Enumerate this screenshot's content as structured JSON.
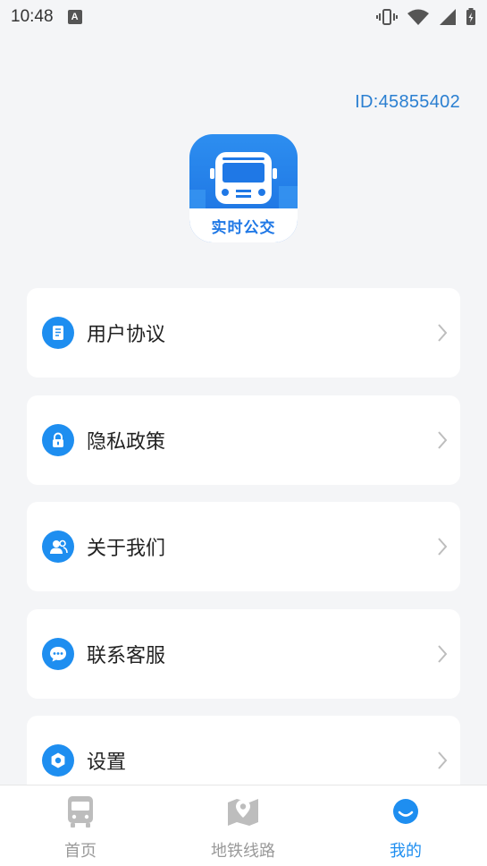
{
  "status_bar": {
    "time": "10:48",
    "indicator": "A"
  },
  "profile": {
    "user_id": "ID:45855402",
    "app_name": "实时公交"
  },
  "menu": [
    {
      "label": "用户协议",
      "icon": "document-icon"
    },
    {
      "label": "隐私政策",
      "icon": "lock-icon"
    },
    {
      "label": "关于我们",
      "icon": "users-icon"
    },
    {
      "label": "联系客服",
      "icon": "chat-icon"
    },
    {
      "label": "设置",
      "icon": "settings-icon"
    }
  ],
  "bottom_nav": [
    {
      "label": "首页",
      "icon": "bus-icon",
      "active": false
    },
    {
      "label": "地铁线路",
      "icon": "map-icon",
      "active": false
    },
    {
      "label": "我的",
      "icon": "profile-icon",
      "active": true
    }
  ],
  "colors": {
    "accent": "#1e8ef0",
    "background": "#f4f5f7",
    "inactive": "#9a9a9a"
  }
}
